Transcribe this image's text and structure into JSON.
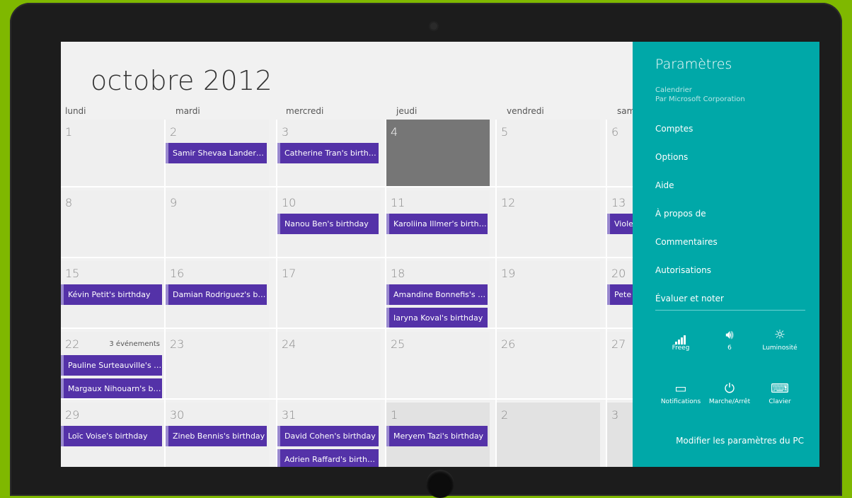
{
  "calendar": {
    "month_title": "octobre 2012",
    "weekdays": [
      "lundi",
      "mardi",
      "mercredi",
      "jeudi",
      "vendredi",
      "sam"
    ],
    "rows": [
      [
        {
          "day": "1",
          "events": []
        },
        {
          "day": "2",
          "events": [
            "Samir Shevaa Landers's..."
          ]
        },
        {
          "day": "3",
          "events": [
            "Catherine Tran's birthday"
          ]
        },
        {
          "day": "4",
          "events": [],
          "today": true
        },
        {
          "day": "5",
          "events": []
        },
        {
          "day": "6",
          "events": []
        }
      ],
      [
        {
          "day": "8",
          "events": []
        },
        {
          "day": "9",
          "events": []
        },
        {
          "day": "10",
          "events": [
            "Nanou Ben's birthday"
          ]
        },
        {
          "day": "11",
          "events": [
            "Karoliina Illmer's birthday"
          ]
        },
        {
          "day": "12",
          "events": []
        },
        {
          "day": "13",
          "events": [
            "Viole"
          ]
        }
      ],
      [
        {
          "day": "15",
          "events": [
            "Kévin Petit's birthday"
          ]
        },
        {
          "day": "16",
          "events": [
            "Damian Rodriguez's birt..."
          ]
        },
        {
          "day": "17",
          "events": []
        },
        {
          "day": "18",
          "events": [
            "Amandine Bonnefis's bir...",
            "Iaryna Koval's birthday"
          ]
        },
        {
          "day": "19",
          "events": []
        },
        {
          "day": "20",
          "events": [
            "Pete"
          ]
        }
      ],
      [
        {
          "day": "22",
          "events": [
            "Pauline Surteauville's bir...",
            "Margaux Nihouarn's birt..."
          ],
          "more": "3 événements"
        },
        {
          "day": "23",
          "events": []
        },
        {
          "day": "24",
          "events": []
        },
        {
          "day": "25",
          "events": []
        },
        {
          "day": "26",
          "events": []
        },
        {
          "day": "27",
          "events": []
        }
      ],
      [
        {
          "day": "29",
          "events": [
            "Loïc Voise's birthday"
          ]
        },
        {
          "day": "30",
          "events": [
            "Zineb Bennis's birthday"
          ]
        },
        {
          "day": "31",
          "events": [
            "David Cohen's birthday",
            "Adrien Raffard's birthday"
          ]
        },
        {
          "day": "1",
          "events": [
            "Meryem Tazi's birthday"
          ],
          "off": true
        },
        {
          "day": "2",
          "events": [],
          "off": true
        },
        {
          "day": "3",
          "events": [],
          "off": true
        }
      ]
    ]
  },
  "charm": {
    "title": "Paramètres",
    "app_name": "Calendrier",
    "publisher": "Par Microsoft Corporation",
    "menu": [
      "Comptes",
      "Options",
      "Aide",
      "À propos de",
      "Commentaires",
      "Autorisations",
      "Évaluer et noter"
    ],
    "quick_settings": [
      {
        "icon": "network-signal-icon",
        "label": "Freeg"
      },
      {
        "icon": "volume-icon",
        "label": "6"
      },
      {
        "icon": "brightness-icon",
        "label": "Luminosité"
      },
      {
        "icon": "notifications-icon",
        "label": "Notifications"
      },
      {
        "icon": "power-icon",
        "label": "Marche/Arrêt"
      },
      {
        "icon": "keyboard-icon",
        "label": "Clavier"
      }
    ],
    "footer_link": "Modifier les paramètres du PC"
  },
  "colors": {
    "event": "#5432a8",
    "charm_bg": "#00a8a8",
    "today": "#767676",
    "frame_bg": "#7fb800"
  }
}
